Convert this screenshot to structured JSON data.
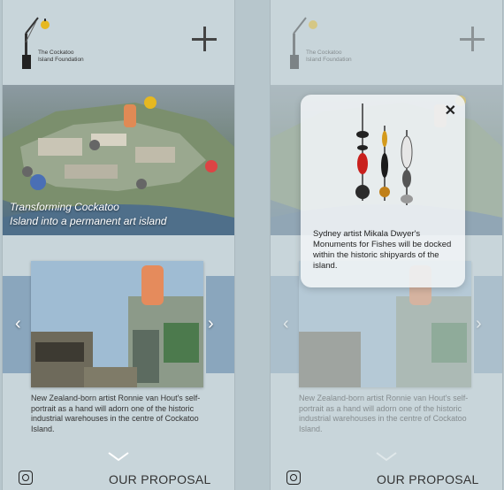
{
  "brand": {
    "line1": "The Cockatoo",
    "line2": "Island Foundation"
  },
  "hero": {
    "caption_line1": "Transforming Cockatoo",
    "caption_line2": "Island into a permanent art island"
  },
  "carousel": {
    "description": "New Zealand-born artist Ronnie van Hout's self-portrait as a hand will adorn one of the historic industrial warehouses in the centre of Cockatoo Island."
  },
  "footer": {
    "proposal_label": "OUR PROPOSAL"
  },
  "modal": {
    "text": "Sydney artist Mikala Dwyer's Monuments for Fishes will be docked within the historic shipyards of the island."
  },
  "icons": {
    "plus": "plus-icon",
    "instagram": "instagram-icon",
    "chevron_left": "chevron-left-icon",
    "chevron_right": "chevron-right-icon",
    "chevron_down": "chevron-down-icon",
    "close": "close-icon"
  },
  "colors": {
    "panel_bg": "#c8d5da",
    "text": "#333333",
    "overlay": "#f0f4f6"
  }
}
